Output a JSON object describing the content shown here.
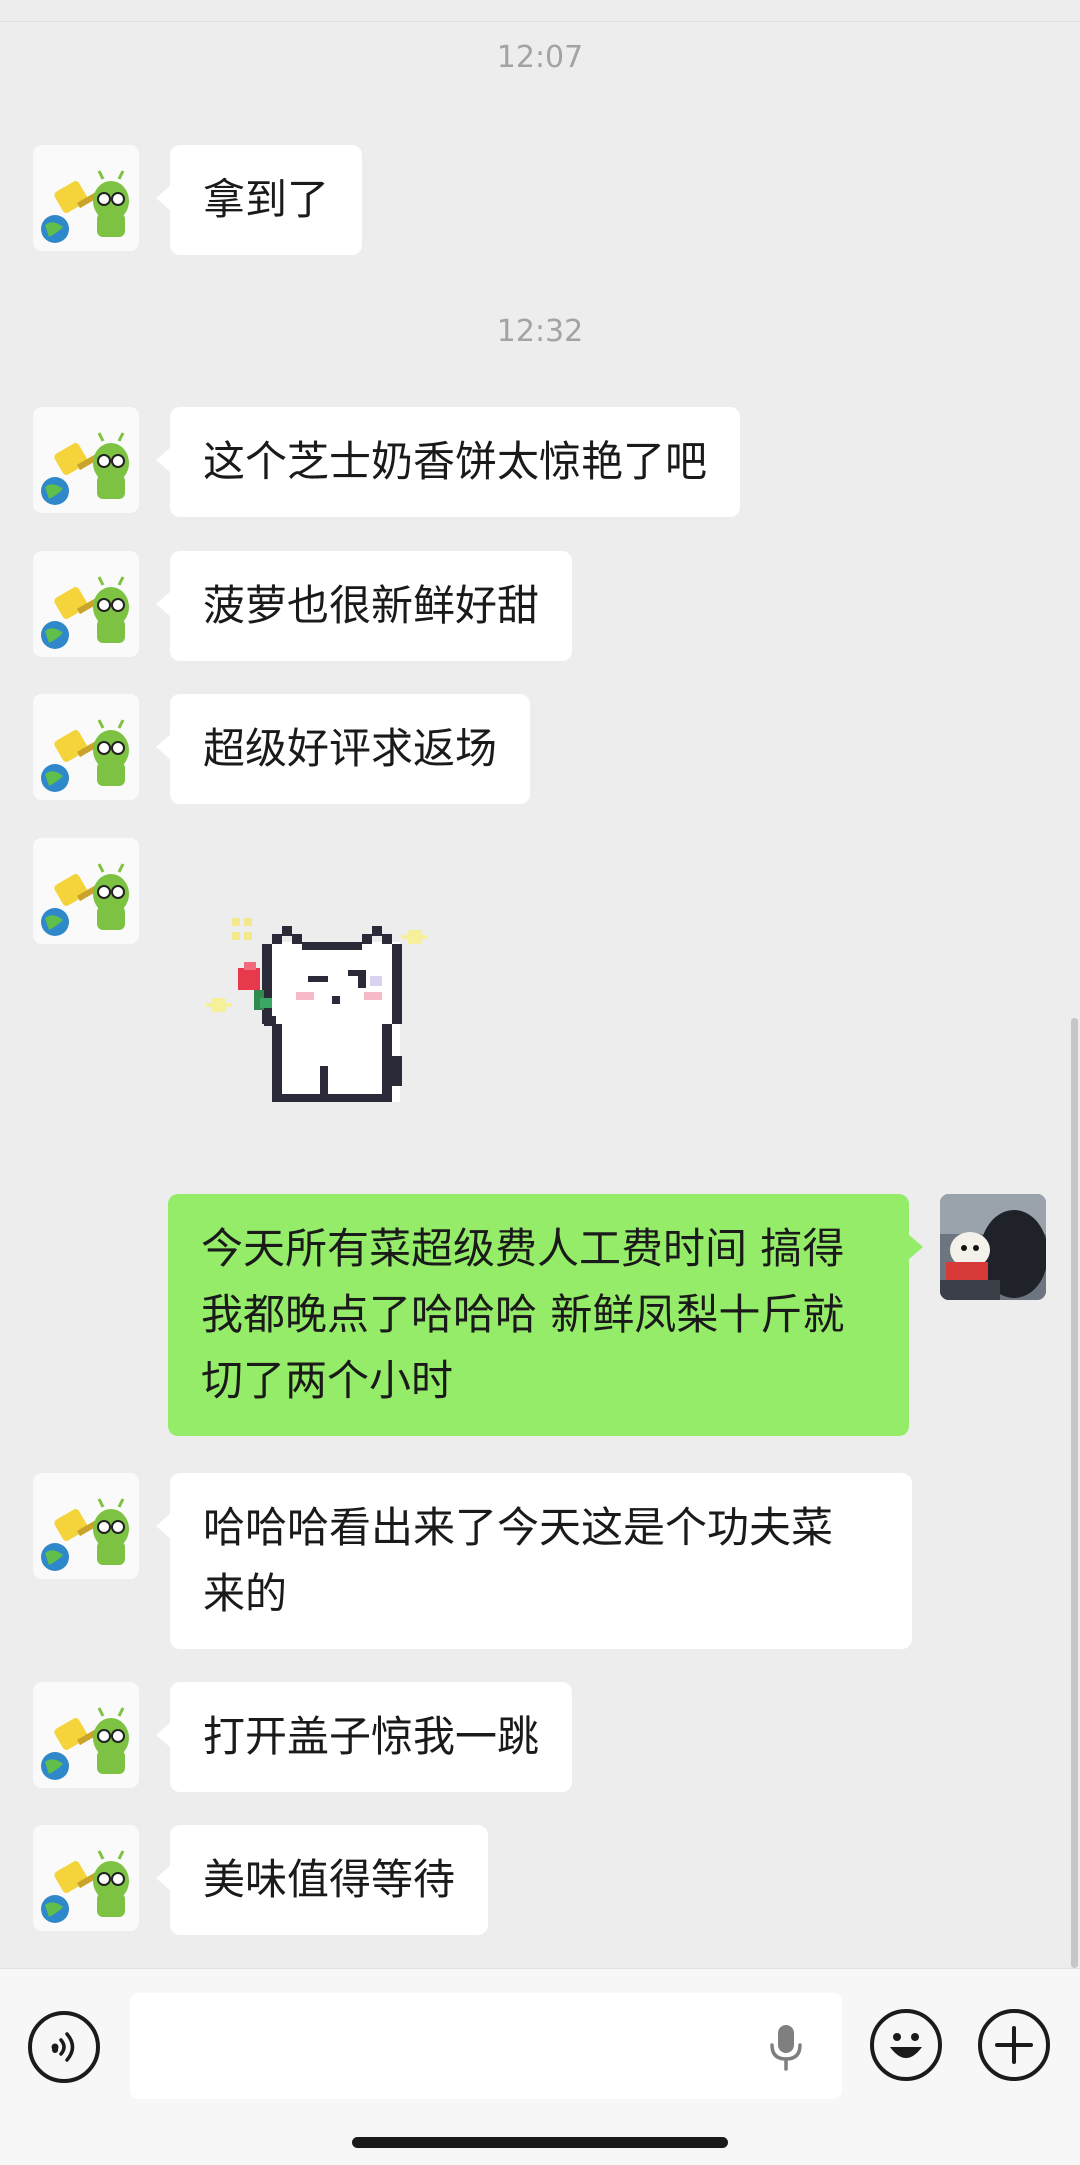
{
  "chat": {
    "timestamps": [
      "12:07",
      "12:32"
    ],
    "messages": [
      {
        "sender": "other",
        "text": "拿到了"
      },
      {
        "sender": "other",
        "text": "这个芝士奶香饼太惊艳了吧"
      },
      {
        "sender": "other",
        "text": "菠萝也很新鲜好甜"
      },
      {
        "sender": "other",
        "text": "超级好评求返场"
      },
      {
        "sender": "other",
        "type": "sticker",
        "sticker_icon": "pixel-cat-sticker-icon"
      },
      {
        "sender": "me",
        "text": "今天所有菜超级费人工费时间 搞得\n我都晚点了哈哈哈 新鲜凤梨十斤就\n切了两个小时"
      },
      {
        "sender": "other",
        "text": "哈哈哈看出来了今天这是个功夫菜\n来的"
      },
      {
        "sender": "other",
        "text": "打开盖子惊我一跳"
      },
      {
        "sender": "other",
        "text": "美味值得等待"
      }
    ]
  },
  "input_bar": {
    "voice_icon": "voice-mode-icon",
    "mic_icon": "microphone-icon",
    "emoji_icon": "emoji-icon",
    "plus_icon": "plus-icon",
    "input_value": ""
  },
  "colors": {
    "background": "#ededed",
    "bubble_other": "#ffffff",
    "bubble_me": "#95ec69",
    "timestamp": "#a3a3a3"
  }
}
